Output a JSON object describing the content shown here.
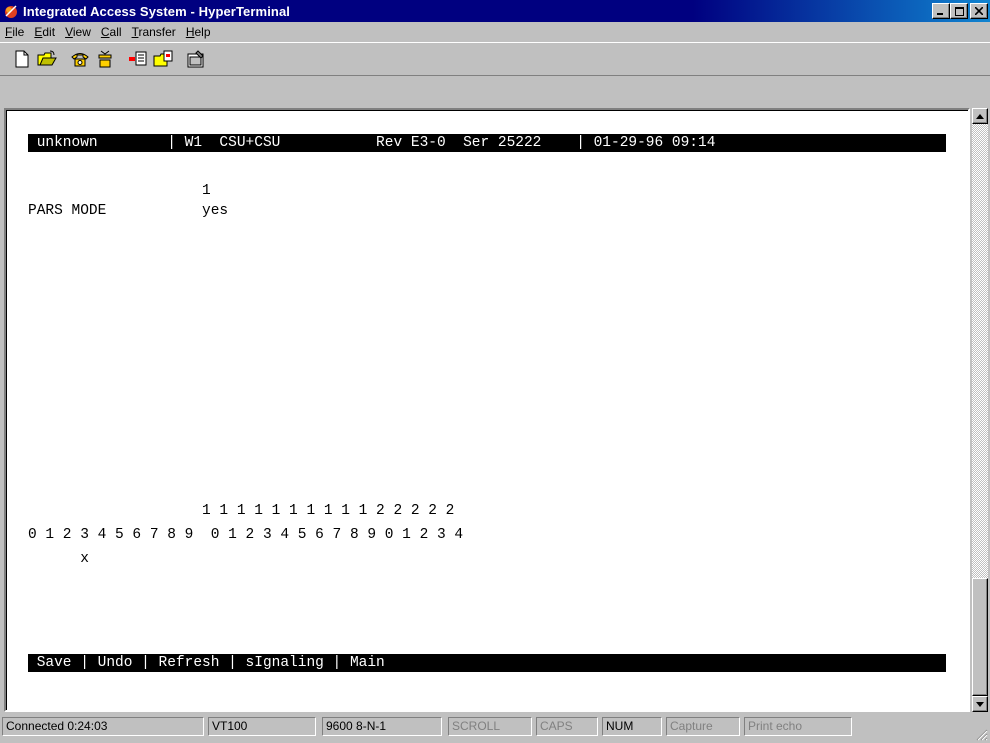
{
  "window": {
    "title": "Integrated Access System - HyperTerminal",
    "buttons": {
      "minimize": "_",
      "maximize": "□",
      "close": "×"
    }
  },
  "menu": [
    {
      "label": "File",
      "accel": "F",
      "rest": "ile"
    },
    {
      "label": "Edit",
      "accel": "E",
      "rest": "dit"
    },
    {
      "label": "View",
      "accel": "V",
      "rest": "iew"
    },
    {
      "label": "Call",
      "accel": "C",
      "rest": "all"
    },
    {
      "label": "Transfer",
      "accel": "T",
      "rest": "ransfer"
    },
    {
      "label": "Help",
      "accel": "H",
      "rest": "elp"
    }
  ],
  "toolbar": {
    "icons": [
      "new-icon",
      "open-icon",
      "connect-icon",
      "disconnect-icon",
      "send-icon",
      "receive-icon",
      "properties-icon"
    ]
  },
  "terminal": {
    "header": " unknown        | W1  CSU+CSU           Rev E3-0  Ser 25222    | 01-29-96 09:14",
    "col_number_line": "                    1",
    "pars_mode_line": "PARS MODE           yes",
    "tens_line": "                    1 1 1 1 1 1 1 1 1 1 2 2 2 2 2",
    "units_line": "0 1 2 3 4 5 6 7 8 9  0 1 2 3 4 5 6 7 8 9 0 1 2 3 4",
    "marker_line": "      x",
    "footer": " Save | Undo | Refresh | sIgnaling | Main"
  },
  "status": {
    "connected": "Connected 0:24:03",
    "emulation": "VT100",
    "settings": "9600 8-N-1",
    "scroll": "SCROLL",
    "caps": "CAPS",
    "num": "NUM",
    "capture": "Capture",
    "print_echo": "Print echo"
  },
  "colors": {
    "title_bar": "#000080",
    "face": "#c0c0c0",
    "terminal_bg": "#ffffff",
    "terminal_fg": "#000000"
  }
}
